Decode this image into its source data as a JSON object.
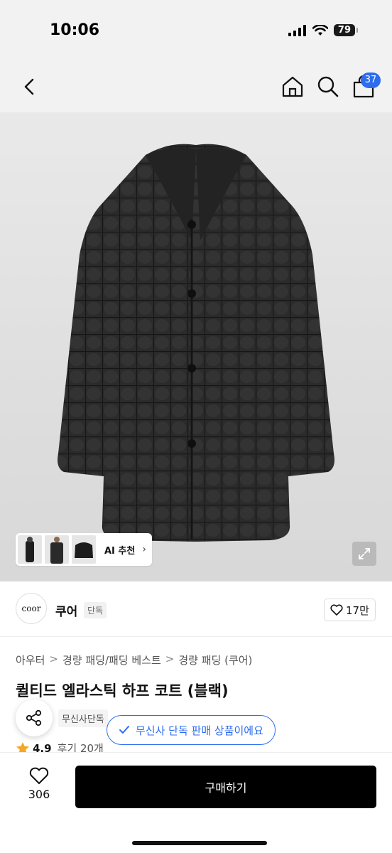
{
  "status": {
    "time": "10:06",
    "battery": "79"
  },
  "nav": {
    "cart_count": "37"
  },
  "gallery": {
    "ai_label": "AI 추천",
    "ai_chevron": "›"
  },
  "brand": {
    "logo_text": "coor",
    "name": "쿠어",
    "tag": "단독",
    "likes": "17만"
  },
  "breadcrumb": {
    "items": [
      "아우터",
      "경량 패딩/패딩 베스트",
      "경량 패딩 (쿠어)"
    ],
    "separator": ">"
  },
  "product": {
    "title": "퀼티드 엘라스틱 하프 코트 (블랙)",
    "tag": "무신사단독",
    "exclusive_notice": "무신사 단독 판매 상품이에요",
    "rating": "4.9",
    "reviews": "후기 20개"
  },
  "bottom_bar": {
    "wish_count": "306",
    "buy_label": "구매하기"
  },
  "colors": {
    "accent": "#2c6df0",
    "buy_button": "#000000",
    "star": "#f5a623"
  },
  "icons": [
    "back-icon",
    "home-icon",
    "search-icon",
    "cart-icon",
    "expand-icon",
    "heart-icon",
    "share-icon",
    "check-icon",
    "star-icon"
  ]
}
